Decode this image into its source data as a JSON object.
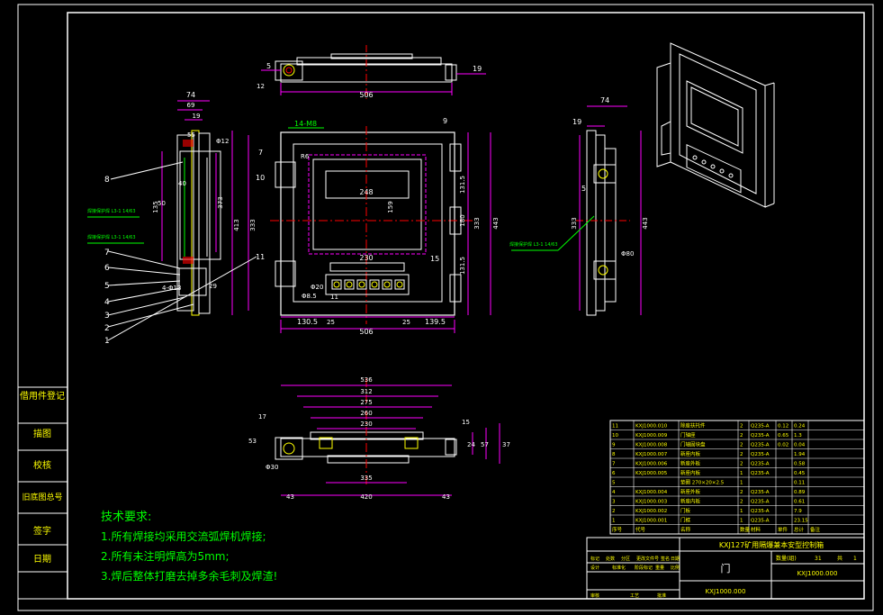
{
  "colors": {
    "background": "#000000",
    "frame": "#ffffff",
    "geometry": "#ffffff",
    "dimension": "#ff00ff",
    "centerline": "#ff0000",
    "text": "#ffffff",
    "leader": "#00ff00",
    "notes": "#00ff00",
    "table_text": "#ffff00"
  },
  "side_panel": {
    "labels": [
      "借用件登记",
      "描图",
      "校核",
      "旧底图总号",
      "签字",
      "日期"
    ]
  },
  "tech_notes": {
    "title": "技术要求:",
    "lines": [
      "1.所有焊接均采用交流弧焊机焊接;",
      "2.所有未注明焊高为5mm;",
      "3.焊后整体打磨去掉多余毛刺及焊渣!"
    ]
  },
  "top_view": {
    "dims": [
      "5",
      "12",
      "19",
      "506"
    ]
  },
  "left_view": {
    "dims": [
      "74",
      "69",
      "19",
      "55",
      "Φ12",
      "40",
      "135",
      "373",
      "413",
      "333",
      "29",
      "4-Φ13",
      "50"
    ],
    "balloons": [
      "8",
      "7",
      "6",
      "5",
      "4",
      "3",
      "2",
      "1"
    ],
    "weld_notes": [
      "焊接保护焊 L3-1 14/63",
      "焊接保护焊 L3-1 14/63"
    ]
  },
  "front_view": {
    "dims": [
      "14-M8",
      "9",
      "7",
      "10",
      "R6",
      "248",
      "159",
      "230",
      "15",
      "Φ20",
      "Φ8.5",
      "11",
      "130.5",
      "25",
      "25",
      "139.5",
      "506",
      "131.5",
      "180",
      "131.5",
      "333",
      "443"
    ],
    "buttons": 6
  },
  "right_view": {
    "dims": [
      "74",
      "19",
      "5",
      "333",
      "443",
      "Φ80"
    ],
    "weld_note": "焊接保护焊 L3-1 14/63"
  },
  "bottom_view": {
    "dims": [
      "536",
      "312",
      "275",
      "260",
      "230",
      "17",
      "15",
      "53",
      "24",
      "57",
      "37",
      "Φ30",
      "335",
      "43",
      "420",
      "43"
    ]
  },
  "iso_view": {
    "caption": ""
  },
  "bom": {
    "rows": [
      [
        "11",
        "KXJ1000.010",
        "除座扶托件",
        "2",
        "Q235-A",
        "0.12",
        "0.24",
        ""
      ],
      [
        "10",
        "KXJ1000.009",
        "门轴座",
        "2",
        "Q235-A",
        "0.65",
        "1.3",
        ""
      ],
      [
        "9",
        "KXJ1000.008",
        "门轴固块盘",
        "2",
        "Q235-A",
        "0.02",
        "0.04",
        ""
      ],
      [
        "8",
        "KXJ1000.007",
        "新座内板",
        "2",
        "Q235-A",
        "",
        "1.94",
        ""
      ],
      [
        "7",
        "KXJ1000.006",
        "新座外板",
        "2",
        "Q235-A",
        "",
        "0.58",
        ""
      ],
      [
        "6",
        "KXJ1000.005",
        "新座内板",
        "1",
        "Q235-A",
        "",
        "0.45",
        ""
      ],
      [
        "5",
        "",
        "垫圈 270×20×2.5",
        "1",
        "",
        "",
        "0.11",
        ""
      ],
      [
        "4",
        "KXJ1000.004",
        "新座外板",
        "2",
        "Q235-A",
        "",
        "0.89",
        ""
      ],
      [
        "3",
        "KXJ1000.003",
        "新座内板",
        "2",
        "Q235-A",
        "",
        "0.61",
        ""
      ],
      [
        "2",
        "KXJ1000.002",
        "门板",
        "1",
        "Q235-A",
        "",
        "7.9",
        ""
      ],
      [
        "1",
        "KXJ1000.001",
        "门框",
        "1",
        "Q235-A",
        "",
        "23.15",
        ""
      ]
    ],
    "header": [
      "序号",
      "代号",
      "名称",
      "数量",
      "材料",
      "单件",
      "总计",
      "备注"
    ],
    "header_extra": [
      "重量 Kg"
    ],
    "title": "KXJ127矿用隔爆兼本安型控制箱",
    "part_name": "门",
    "drawing_no": "KXJ1000.000",
    "drawing_no_2": "KXJ1000.000",
    "scale_label": "数量(组)",
    "scale_value": "31",
    "sheet_label": "共",
    "sheet_value": "1",
    "labels_row": [
      "标记",
      "处数",
      "分区",
      "更改文件号",
      "签名",
      "日期"
    ],
    "labels_row2": [
      "设计",
      "标准化",
      "阶段标记",
      "重量",
      "比例"
    ],
    "labels_row3": [
      "审核",
      "",
      "工艺",
      "批准"
    ],
    "sign_labels": [
      "共",
      "张",
      "第",
      "张"
    ]
  }
}
